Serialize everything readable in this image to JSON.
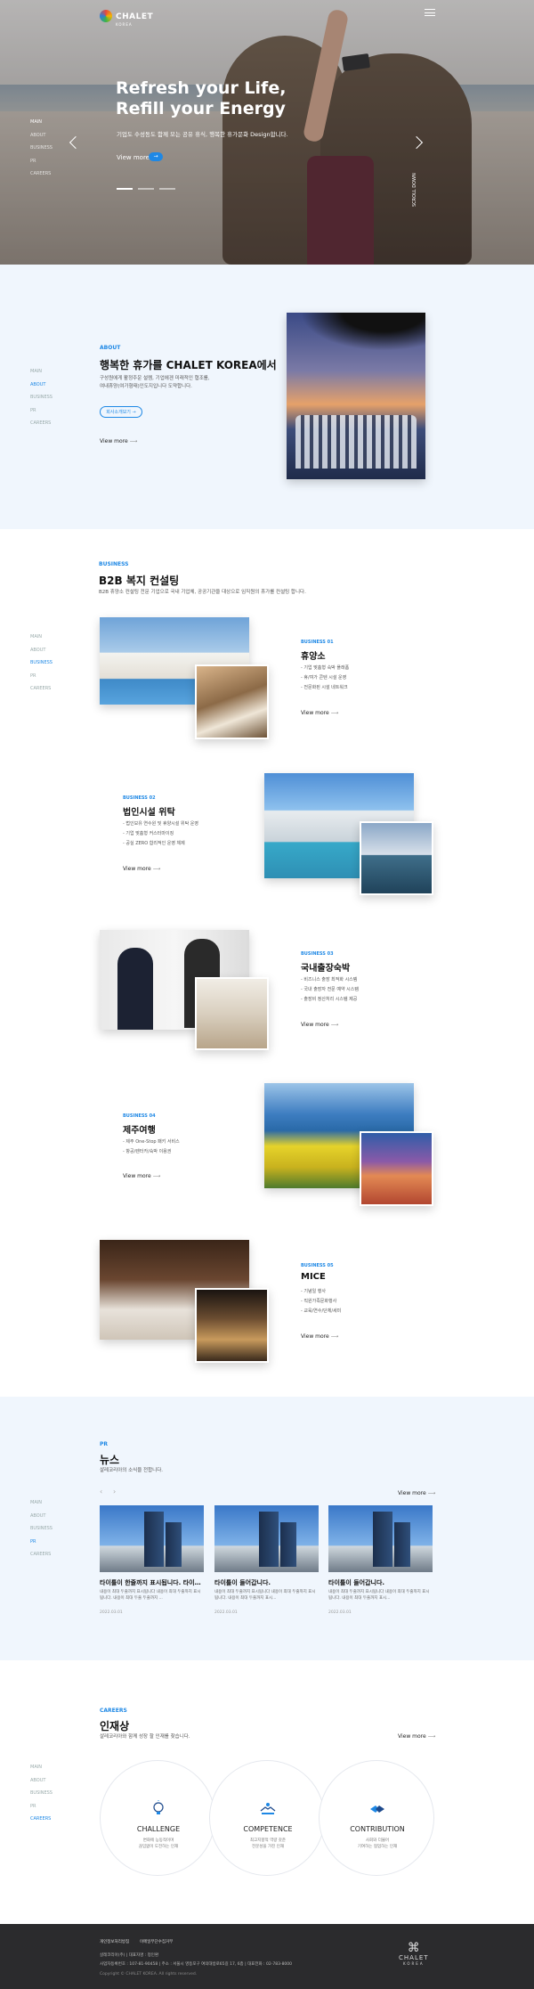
{
  "header": {
    "logo_text": "CHALET",
    "logo_sub": "KOREA",
    "menu_icon": "hamburger-icon"
  },
  "hero": {
    "title_line1": "Refresh your Life,",
    "title_line2": "Refill your Energy",
    "subtitle": "기업도 수성동도 함께 모는 공유 휴식, 행복한 휴가문화 Design합니다.",
    "view_more": "View more",
    "view_more_btn": "→",
    "scroll_text": "SCROLL DOWN"
  },
  "sidenav": {
    "items": [
      "MAIN",
      "ABOUT",
      "BUSINESS",
      "PR",
      "CAREERS"
    ]
  },
  "about": {
    "label": "ABOUT",
    "title": "행복한 휴가를 CHALET KOREA에서",
    "desc1": "구성원에게 활정주운 설렘, 기업에겐 미래적인 협조를,",
    "desc2": "여내휴양(여가형태)인도지입니다 도약합니다.",
    "pill": "회사소개보기 →",
    "view_more": "View more"
  },
  "business": {
    "label": "BUSINESS",
    "title": "B2B 복지 컨설팅",
    "desc": "B2B 휴양소 컨설팅 전문 기업으로 국내 기업체, 공공기관을 대상으로 임직원의 휴가를 컨설팅 합니다.",
    "items": [
      {
        "label": "BUSINESS 01",
        "title": "휴양소",
        "lines": [
          "기업 맞춤형 숙박 플래폼",
          "휴/여가 콘텐 시설 운영",
          "전문화된 시설 네트워크"
        ],
        "view_more": "View more"
      },
      {
        "label": "BUSINESS 02",
        "title": "법인시설 위탁",
        "lines": [
          "법인보유 연수원 및 휴양시설 위탁 운영",
          "기업 맞춤형 커스터마이징",
          "공실 ZERO 합리적인 운영 체제"
        ],
        "view_more": "View more"
      },
      {
        "label": "BUSINESS 03",
        "title": "국내출장숙박",
        "lines": [
          "비즈니스 출장 최적화 시스템",
          "국내 출장자 전문 예약 시스템",
          "출장비 정산처리 시스템 제공"
        ],
        "view_more": "View more"
      },
      {
        "label": "BUSINESS 04",
        "title": "제주여행",
        "lines": [
          "제주 One-Stop 패키 서비스",
          "항공/렌터카/숙박 이용권"
        ],
        "view_more": "View more"
      },
      {
        "label": "BUSINESS 05",
        "title": "MICE",
        "lines": [
          "기념일 행사",
          "직원가족문화행사",
          "교육/연수/단체/세미"
        ],
        "view_more": "View more"
      }
    ]
  },
  "pr": {
    "label": "PR",
    "title": "뉴스",
    "desc": "샬레코리아의 소식을 전합니다.",
    "view_more": "View more",
    "prev_icon": "‹",
    "next_icon": "›",
    "news": [
      {
        "title": "타이틀이 한줄까지 표시됩니다. 타이틀...",
        "desc": "내용이 최대 두줄까지 표시됩니다 내용이 최대 두줄까지 표시됩니다. 내용이 최대 두줄 두줄까지 ...",
        "date": "2022.03.01"
      },
      {
        "title": "타이틀이 들어갑니다.",
        "desc": "내용이 최대 두줄까지 표시됩니다 내용이 최대 두줄까지 표시됩니다. 내용이 최대 두줄까지 표시...",
        "date": "2022.03.01"
      },
      {
        "title": "타이틀이 들어갑니다.",
        "desc": "내용이 최대 두줄까지 표시됩니다 내용이 최대 두줄까지 표시됩니다. 내용이 최대 두줄까지 표시...",
        "date": "2022.03.01"
      }
    ]
  },
  "careers": {
    "label": "CAREERS",
    "title": "인재상",
    "desc": "샬레코리아와 함께 성장 할 인재를 찾습니다.",
    "view_more": "View more",
    "values": [
      {
        "title": "CHALLENGE",
        "desc1": "변화에 능동적이며",
        "desc2": "끊임없이 도전하는 인재",
        "icon": "lightbulb-icon"
      },
      {
        "title": "COMPETENCE",
        "desc1": "최고지향적 역량 갖춘",
        "desc2": "전문성을 가진 인재",
        "icon": "handshake-icon"
      },
      {
        "title": "CONTRIBUTION",
        "desc1": "사회와 더불어",
        "desc2": "기여하는 협업하는 인재",
        "icon": "hands-icon"
      }
    ]
  },
  "footer": {
    "links": [
      "개인정보처리방침",
      "이메일무단수집거부"
    ],
    "company": "샬레코리아(주)  |  대표자명 : 정인환",
    "info": "사업자등록번호 : 107-81-90458  |  주소 : 서울시 영등포구 여의대방로65길 17, 6층  |  대표전화 : 02-783-8000",
    "copyright": "Copyright © CHALET KOREA. All rights reserved.",
    "logo_text": "CHALET",
    "logo_sub": "KOREA"
  },
  "colors": {
    "accent": "#1e88e5",
    "footer_bg": "#2b2b2d",
    "section_bg": "#f0f6fd"
  }
}
